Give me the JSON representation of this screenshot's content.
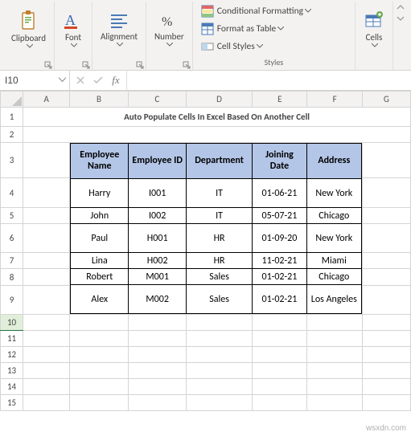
{
  "ribbon": {
    "groups": {
      "clipboard": {
        "label": "Clipboard"
      },
      "font": {
        "label": "Font"
      },
      "alignment": {
        "label": "Alignment"
      },
      "number": {
        "label": "Number"
      },
      "styles": {
        "label": "Styles",
        "items": {
          "cond_fmt": "Conditional Formatting",
          "as_table": "Format as Table",
          "cell_styles": "Cell Styles"
        }
      },
      "cells": {
        "label": "Cells"
      }
    }
  },
  "namebox": {
    "value": "I10"
  },
  "formula_bar": {
    "fx_label": "fx",
    "value": ""
  },
  "columns": [
    "A",
    "B",
    "C",
    "D",
    "E",
    "F",
    "G"
  ],
  "row_headers": [
    "1",
    "2",
    "3",
    "4",
    "5",
    "6",
    "7",
    "8",
    "9",
    "10",
    "11",
    "12",
    "13",
    "14",
    "15"
  ],
  "title": "Auto Populate Cells In Excel Based On Another Cell",
  "chart_data": {
    "type": "table",
    "headers": [
      "Employee Name",
      "Employee ID",
      "Department",
      "Joining Date",
      "Address"
    ],
    "rows": [
      [
        "Harry",
        "I001",
        "IT",
        "01-06-21",
        "New York"
      ],
      [
        "John",
        "I002",
        "IT",
        "05-07-21",
        "Chicago"
      ],
      [
        "Paul",
        "H001",
        "HR",
        "01-09-20",
        "New York"
      ],
      [
        "Lina",
        "H002",
        "HR",
        "11-02-21",
        "Miami"
      ],
      [
        "Robert",
        "M001",
        "Sales",
        "01-02-21",
        "Chicago"
      ],
      [
        "Alex",
        "M002",
        "Sales",
        "01-02-21",
        "Los Angeles"
      ]
    ]
  },
  "watermark": "wsxdn.com"
}
